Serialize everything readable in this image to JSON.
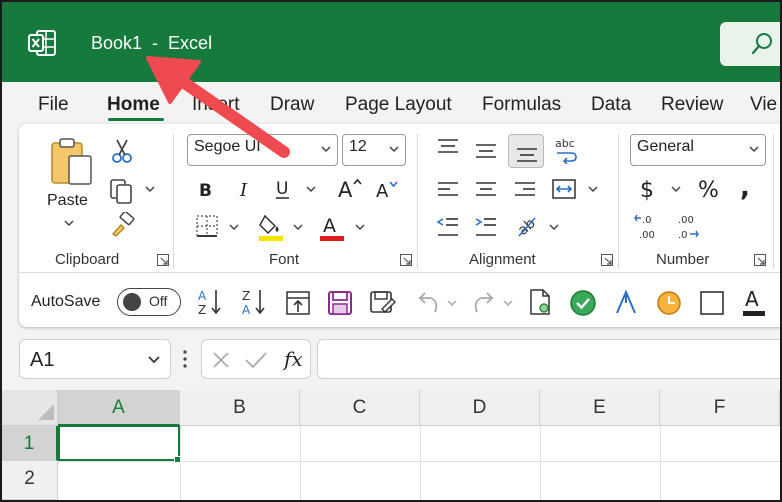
{
  "window": {
    "workbook_name": "Book1",
    "separator": "-",
    "app_name": "Excel"
  },
  "menu_tabs": [
    "File",
    "Home",
    "Insert",
    "Draw",
    "Page Layout",
    "Formulas",
    "Data",
    "Review",
    "Vie"
  ],
  "active_tab": "Home",
  "ribbon": {
    "clipboard": {
      "paste_label": "Paste",
      "group_label": "Clipboard"
    },
    "font": {
      "font_name": "Segoe UI",
      "font_size": "12",
      "group_label": "Font"
    },
    "alignment": {
      "group_label": "Alignment"
    },
    "number": {
      "format": "General",
      "group_label": "Number"
    }
  },
  "quick_access": {
    "autosave_label": "AutoSave",
    "toggle_state": "Off"
  },
  "formula_bar": {
    "name_box": "A1",
    "fx_label": "fx",
    "formula": ""
  },
  "grid": {
    "columns": [
      "A",
      "B",
      "C",
      "D",
      "E",
      "F"
    ],
    "rows": [
      "1",
      "2"
    ],
    "selected_cell": "A1"
  },
  "colors": {
    "brand_green": "#167a3d",
    "annotation_red": "#ef4a4f",
    "highlight_yellow": "#f5e400",
    "font_red": "#e11b1b"
  }
}
